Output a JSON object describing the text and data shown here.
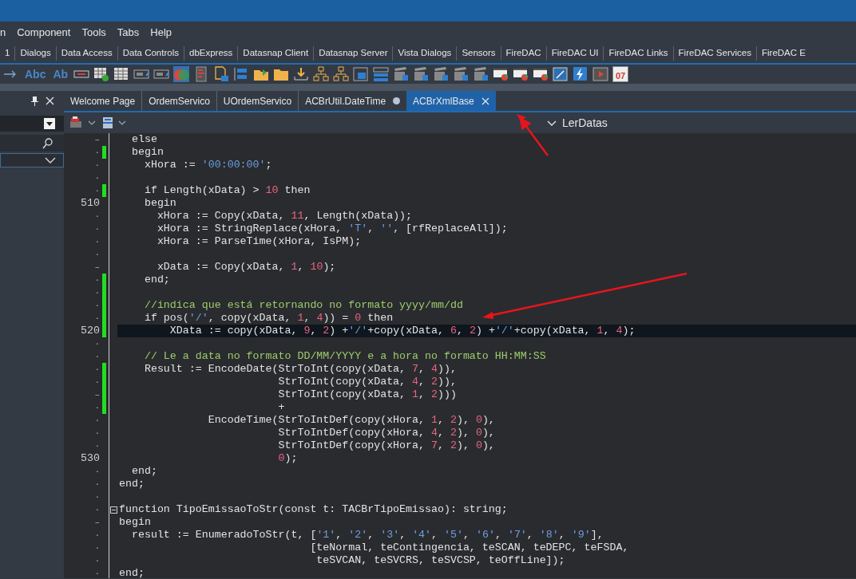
{
  "menu": [
    "n",
    "Component",
    "Tools",
    "Tabs",
    "Help"
  ],
  "palette_tabs": [
    "1",
    "Dialogs",
    "Data Access",
    "Data Controls",
    "dbExpress",
    "Datasnap Client",
    "Datasnap Server",
    "Vista Dialogs",
    "Sensors",
    "FireDAC",
    "FireDAC UI",
    "FireDAC Links",
    "FireDAC Services",
    "FireDAC E"
  ],
  "toolbar": {
    "text_buttons": [
      "Abc",
      "Ab"
    ],
    "calendar_day": "07"
  },
  "editor_tabs": [
    {
      "label": "Welcome Page",
      "selected": false,
      "modified": false
    },
    {
      "label": "OrdemServico",
      "selected": false,
      "modified": false
    },
    {
      "label": "UOrdemServico",
      "selected": false,
      "modified": false
    },
    {
      "label": "ACBrUtil.DateTime",
      "selected": false,
      "modified": true
    },
    {
      "label": "ACBrXmlBase",
      "selected": true,
      "modified": false
    }
  ],
  "method_nav": {
    "label": "LerDatas"
  },
  "code_lines": [
    {
      "mark": "–",
      "changed": false,
      "current": false,
      "segments": [
        {
          "kind": "plain",
          "text": "  else"
        }
      ]
    },
    {
      "mark": "·",
      "changed": true,
      "current": false,
      "segments": [
        {
          "kind": "plain",
          "text": "  begin"
        }
      ]
    },
    {
      "mark": "·",
      "changed": false,
      "current": false,
      "segments": [
        {
          "kind": "plain",
          "text": "    xHora := "
        },
        {
          "kind": "string",
          "text": "'00:00:00'"
        },
        {
          "kind": "plain",
          "text": ";"
        }
      ]
    },
    {
      "mark": "·",
      "changed": false,
      "current": false
    },
    {
      "mark": "·",
      "changed": true,
      "current": false,
      "segments": [
        {
          "kind": "plain",
          "text": "    if Length(xData) > "
        },
        {
          "kind": "number",
          "text": "10"
        },
        {
          "kind": "plain",
          "text": " then"
        }
      ]
    },
    {
      "number": "510",
      "changed": false,
      "current": false,
      "segments": [
        {
          "kind": "plain",
          "text": "    begin"
        }
      ]
    },
    {
      "mark": "·",
      "changed": false,
      "current": false,
      "segments": [
        {
          "kind": "plain",
          "text": "      xHora := Copy(xData, "
        },
        {
          "kind": "number",
          "text": "11"
        },
        {
          "kind": "plain",
          "text": ", Length(xData));"
        }
      ]
    },
    {
      "mark": "·",
      "changed": false,
      "current": false,
      "segments": [
        {
          "kind": "plain",
          "text": "      xHora := StringReplace(xHora, "
        },
        {
          "kind": "string",
          "text": "'T'"
        },
        {
          "kind": "plain",
          "text": ", "
        },
        {
          "kind": "string",
          "text": "''"
        },
        {
          "kind": "plain",
          "text": ", [rfReplaceAll]);"
        }
      ]
    },
    {
      "mark": "·",
      "changed": false,
      "current": false,
      "segments": [
        {
          "kind": "plain",
          "text": "      xHora := ParseTime(xHora, IsPM);"
        }
      ]
    },
    {
      "mark": "·",
      "changed": false,
      "current": false
    },
    {
      "mark": "–",
      "changed": false,
      "current": false,
      "segments": [
        {
          "kind": "plain",
          "text": "      xData := Copy(xData, "
        },
        {
          "kind": "number",
          "text": "1"
        },
        {
          "kind": "plain",
          "text": ", "
        },
        {
          "kind": "number",
          "text": "10"
        },
        {
          "kind": "plain",
          "text": ");"
        }
      ]
    },
    {
      "mark": "·",
      "changed": true,
      "current": false,
      "segments": [
        {
          "kind": "plain",
          "text": "    end;"
        }
      ]
    },
    {
      "mark": "·",
      "changed": true,
      "current": false
    },
    {
      "mark": "·",
      "changed": true,
      "current": false,
      "segments": [
        {
          "kind": "comment",
          "text": "    //indica que está retornando no formato yyyy/mm/dd"
        }
      ]
    },
    {
      "mark": "·",
      "changed": true,
      "current": false,
      "segments": [
        {
          "kind": "plain",
          "text": "    if pos("
        },
        {
          "kind": "string",
          "text": "'/'"
        },
        {
          "kind": "plain",
          "text": ", copy(xData, "
        },
        {
          "kind": "number",
          "text": "1"
        },
        {
          "kind": "plain",
          "text": ", "
        },
        {
          "kind": "number",
          "text": "4"
        },
        {
          "kind": "plain",
          "text": ")) = "
        },
        {
          "kind": "number",
          "text": "0"
        },
        {
          "kind": "plain",
          "text": " then"
        }
      ]
    },
    {
      "number": "520",
      "changed": true,
      "current": true,
      "segments": [
        {
          "kind": "plain",
          "text": "        XData := copy(xData, "
        },
        {
          "kind": "number",
          "text": "9"
        },
        {
          "kind": "plain",
          "text": ", "
        },
        {
          "kind": "number",
          "text": "2"
        },
        {
          "kind": "plain",
          "text": ") +"
        },
        {
          "kind": "string",
          "text": "'/'"
        },
        {
          "kind": "plain",
          "text": "+copy(xData, "
        },
        {
          "kind": "number",
          "text": "6"
        },
        {
          "kind": "plain",
          "text": ", "
        },
        {
          "kind": "number",
          "text": "2"
        },
        {
          "kind": "plain",
          "text": ") +"
        },
        {
          "kind": "string",
          "text": "'/'"
        },
        {
          "kind": "plain",
          "text": "+copy(xData, "
        },
        {
          "kind": "number",
          "text": "1"
        },
        {
          "kind": "plain",
          "text": ", "
        },
        {
          "kind": "number",
          "text": "4"
        },
        {
          "kind": "plain",
          "text": ");"
        }
      ]
    },
    {
      "mark": "·",
      "changed": false,
      "current": false
    },
    {
      "mark": "·",
      "changed": false,
      "current": false,
      "segments": [
        {
          "kind": "comment",
          "text": "    // Le a data no formato DD/MM/YYYY e a hora no formato HH:MM:SS"
        }
      ]
    },
    {
      "mark": "·",
      "changed": true,
      "current": false,
      "segments": [
        {
          "kind": "plain",
          "text": "    Result := EncodeDate(StrToInt(copy(xData, "
        },
        {
          "kind": "number",
          "text": "7"
        },
        {
          "kind": "plain",
          "text": ", "
        },
        {
          "kind": "number",
          "text": "4"
        },
        {
          "kind": "plain",
          "text": ")),"
        }
      ]
    },
    {
      "mark": "·",
      "changed": true,
      "current": false,
      "segments": [
        {
          "kind": "plain",
          "text": "                         StrToInt(copy(xData, "
        },
        {
          "kind": "number",
          "text": "4"
        },
        {
          "kind": "plain",
          "text": ", "
        },
        {
          "kind": "number",
          "text": "2"
        },
        {
          "kind": "plain",
          "text": ")),"
        }
      ]
    },
    {
      "mark": "–",
      "changed": true,
      "current": false,
      "segments": [
        {
          "kind": "plain",
          "text": "                         StrToInt(copy(xData, "
        },
        {
          "kind": "number",
          "text": "1"
        },
        {
          "kind": "plain",
          "text": ", "
        },
        {
          "kind": "number",
          "text": "2"
        },
        {
          "kind": "plain",
          "text": ")))"
        }
      ]
    },
    {
      "mark": "·",
      "changed": true,
      "current": false,
      "segments": [
        {
          "kind": "plain",
          "text": "                         +"
        }
      ]
    },
    {
      "mark": "·",
      "changed": false,
      "current": false,
      "segments": [
        {
          "kind": "plain",
          "text": "              EncodeTime(StrToIntDef(copy(xHora, "
        },
        {
          "kind": "number",
          "text": "1"
        },
        {
          "kind": "plain",
          "text": ", "
        },
        {
          "kind": "number",
          "text": "2"
        },
        {
          "kind": "plain",
          "text": "), "
        },
        {
          "kind": "number",
          "text": "0"
        },
        {
          "kind": "plain",
          "text": "),"
        }
      ]
    },
    {
      "mark": "·",
      "changed": false,
      "current": false,
      "segments": [
        {
          "kind": "plain",
          "text": "                         StrToIntDef(copy(xHora, "
        },
        {
          "kind": "number",
          "text": "4"
        },
        {
          "kind": "plain",
          "text": ", "
        },
        {
          "kind": "number",
          "text": "2"
        },
        {
          "kind": "plain",
          "text": "), "
        },
        {
          "kind": "number",
          "text": "0"
        },
        {
          "kind": "plain",
          "text": "),"
        }
      ]
    },
    {
      "mark": "·",
      "changed": false,
      "current": false,
      "segments": [
        {
          "kind": "plain",
          "text": "                         StrToIntDef(copy(xHora, "
        },
        {
          "kind": "number",
          "text": "7"
        },
        {
          "kind": "plain",
          "text": ", "
        },
        {
          "kind": "number",
          "text": "2"
        },
        {
          "kind": "plain",
          "text": "), "
        },
        {
          "kind": "number",
          "text": "0"
        },
        {
          "kind": "plain",
          "text": "),"
        }
      ]
    },
    {
      "number": "530",
      "changed": false,
      "current": false,
      "segments": [
        {
          "kind": "number",
          "text": "                         0"
        },
        {
          "kind": "plain",
          "text": ");"
        }
      ]
    },
    {
      "mark": "·",
      "changed": false,
      "current": false,
      "segments": [
        {
          "kind": "plain",
          "text": "  end;"
        }
      ]
    },
    {
      "mark": "·",
      "changed": false,
      "current": false,
      "segments": [
        {
          "kind": "plain",
          "text": "end;"
        }
      ]
    },
    {
      "mark": "·",
      "changed": false,
      "current": false
    },
    {
      "mark": "·",
      "changed": false,
      "current": false,
      "fold": true,
      "segments": [
        {
          "kind": "plain",
          "text": "function TipoEmissaoToStr(const t: TACBrTipoEmissao): string;"
        }
      ]
    },
    {
      "mark": "–",
      "changed": false,
      "current": false,
      "segments": [
        {
          "kind": "plain",
          "text": "begin"
        }
      ]
    },
    {
      "mark": "·",
      "changed": false,
      "current": false,
      "segments": [
        {
          "kind": "plain",
          "text": "  result := EnumeradoToStr(t, ["
        },
        {
          "kind": "string",
          "text": "'1'"
        },
        {
          "kind": "plain",
          "text": ", "
        },
        {
          "kind": "string",
          "text": "'2'"
        },
        {
          "kind": "plain",
          "text": ", "
        },
        {
          "kind": "string",
          "text": "'3'"
        },
        {
          "kind": "plain",
          "text": ", "
        },
        {
          "kind": "string",
          "text": "'4'"
        },
        {
          "kind": "plain",
          "text": ", "
        },
        {
          "kind": "string",
          "text": "'5'"
        },
        {
          "kind": "plain",
          "text": ", "
        },
        {
          "kind": "string",
          "text": "'6'"
        },
        {
          "kind": "plain",
          "text": ", "
        },
        {
          "kind": "string",
          "text": "'7'"
        },
        {
          "kind": "plain",
          "text": ", "
        },
        {
          "kind": "string",
          "text": "'8'"
        },
        {
          "kind": "plain",
          "text": ", "
        },
        {
          "kind": "string",
          "text": "'9'"
        },
        {
          "kind": "plain",
          "text": "],"
        }
      ]
    },
    {
      "mark": "·",
      "changed": false,
      "current": false,
      "segments": [
        {
          "kind": "plain",
          "text": "                              [teNormal, teContingencia, teSCAN, teDEPC, teFSDA,"
        }
      ]
    },
    {
      "mark": "·",
      "changed": false,
      "current": false,
      "segments": [
        {
          "kind": "plain",
          "text": "                               teSVCAN, teSVCRS, teSVCSP, teOffLine]);"
        }
      ]
    },
    {
      "mark": "·",
      "changed": false,
      "current": false,
      "segments": [
        {
          "kind": "plain",
          "text": "end;"
        }
      ]
    }
  ]
}
